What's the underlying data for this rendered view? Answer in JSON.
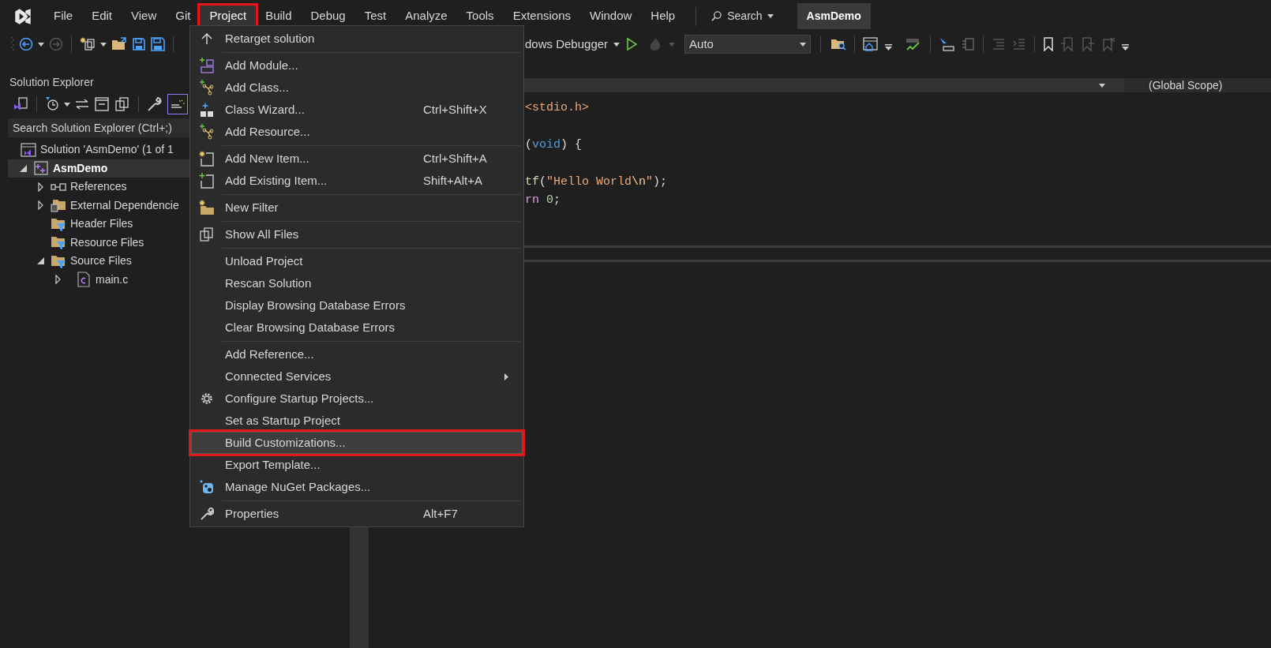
{
  "menubar": [
    {
      "label": "File",
      "open": false,
      "annotated": false
    },
    {
      "label": "Edit",
      "open": false,
      "annotated": false
    },
    {
      "label": "View",
      "open": false,
      "annotated": false
    },
    {
      "label": "Git",
      "open": false,
      "annotated": false
    },
    {
      "label": "Project",
      "open": true,
      "annotated": true
    },
    {
      "label": "Build",
      "open": false,
      "annotated": false
    },
    {
      "label": "Debug",
      "open": false,
      "annotated": false
    },
    {
      "label": "Test",
      "open": false,
      "annotated": false
    },
    {
      "label": "Analyze",
      "open": false,
      "annotated": false
    },
    {
      "label": "Tools",
      "open": false,
      "annotated": false
    },
    {
      "label": "Extensions",
      "open": false,
      "annotated": false
    },
    {
      "label": "Window",
      "open": false,
      "annotated": false
    },
    {
      "label": "Help",
      "open": false,
      "annotated": false
    }
  ],
  "search": "Search",
  "solution_badge": "AsmDemo",
  "toolbar": {
    "debugger": "dows Debugger",
    "configuration": "Auto"
  },
  "solution_explorer": {
    "title": "Solution Explorer",
    "search": {
      "placeholder": "Search Solution Explorer (Ctrl+;)"
    },
    "tree": [
      {
        "label": "Solution 'AsmDemo' (1 of 1",
        "kind": "solution",
        "expandable": false,
        "selected": false,
        "children": [
          {
            "label": "AsmDemo",
            "kind": "project",
            "expandable": true,
            "expanded": true,
            "selected": true,
            "children": [
              {
                "label": "References",
                "kind": "references",
                "expandable": true,
                "expanded": false,
                "selected": false
              },
              {
                "label": "External Dependencie",
                "kind": "external",
                "expandable": true,
                "expanded": false,
                "selected": false
              },
              {
                "label": "Header Files",
                "kind": "filter",
                "expandable": false,
                "selected": false
              },
              {
                "label": "Resource Files",
                "kind": "filter",
                "expandable": false,
                "selected": false
              },
              {
                "label": "Source Files",
                "kind": "filter",
                "expandable": true,
                "expanded": true,
                "selected": false,
                "children": [
                  {
                    "label": "main.c",
                    "kind": "file",
                    "expandable": true,
                    "expanded": false,
                    "selected": false
                  }
                ]
              }
            ]
          }
        ]
      }
    ]
  },
  "editor": {
    "scope": "(Global Scope)",
    "code_lines": [
      [
        {
          "text": "<stdio.h>",
          "kind": "string"
        }
      ],
      [
        {
          "text": "(",
          "kind": "punct"
        },
        {
          "text": "void",
          "kind": "keyword"
        },
        {
          "text": ") {",
          "kind": "punct"
        }
      ],
      [
        {
          "text": "tf",
          "kind": "function"
        },
        {
          "text": "(",
          "kind": "punct"
        },
        {
          "text": "\"Hello World",
          "kind": "string"
        },
        {
          "text": "\\n",
          "kind": "escape"
        },
        {
          "text": "\"",
          "kind": "string"
        },
        {
          "text": ");",
          "kind": "punct"
        }
      ],
      [
        {
          "text": "rn",
          "kind": "control"
        },
        {
          "text": " 0",
          "kind": "number"
        },
        {
          "text": ";",
          "kind": "punct"
        }
      ]
    ]
  },
  "project_menu": {
    "groups": [
      [
        {
          "label": "Retarget solution",
          "kind": "retarget",
          "submenu": false,
          "selected": false,
          "annotated": false
        }
      ],
      [
        {
          "label": "Add Module...",
          "kind": "module",
          "submenu": false,
          "selected": false,
          "annotated": false
        },
        {
          "label": "Add Class...",
          "kind": "class",
          "submenu": false,
          "selected": false,
          "annotated": false
        },
        {
          "label": "Class Wizard...",
          "kind": "wizard",
          "shortcut": "Ctrl+Shift+X",
          "submenu": false,
          "selected": false,
          "annotated": false
        },
        {
          "label": "Add Resource...",
          "kind": "class",
          "submenu": false,
          "selected": false,
          "annotated": false
        }
      ],
      [
        {
          "label": "Add New Item...",
          "kind": "new-item",
          "shortcut": "Ctrl+Shift+A",
          "submenu": false,
          "selected": false,
          "annotated": false
        },
        {
          "label": "Add Existing Item...",
          "kind": "existing-item",
          "shortcut": "Shift+Alt+A",
          "submenu": false,
          "selected": false,
          "annotated": false
        }
      ],
      [
        {
          "label": "New Filter",
          "kind": "filter",
          "submenu": false,
          "selected": false,
          "annotated": false
        }
      ],
      [
        {
          "label": "Show All Files",
          "kind": "show-all",
          "submenu": false,
          "selected": false,
          "annotated": false
        }
      ],
      [
        {
          "label": "Unload Project",
          "kind": "plain",
          "submenu": false,
          "selected": false,
          "annotated": false
        },
        {
          "label": "Rescan Solution",
          "kind": "plain",
          "submenu": false,
          "selected": false,
          "annotated": false
        },
        {
          "label": "Display Browsing Database Errors",
          "kind": "plain",
          "submenu": false,
          "selected": false,
          "annotated": false
        },
        {
          "label": "Clear Browsing Database Errors",
          "kind": "plain",
          "submenu": false,
          "selected": false,
          "annotated": false
        }
      ],
      [
        {
          "label": "Add Reference...",
          "kind": "plain",
          "submenu": false,
          "selected": false,
          "annotated": false
        },
        {
          "label": "Connected Services",
          "kind": "plain",
          "submenu": true,
          "selected": false,
          "annotated": false
        },
        {
          "label": "Configure Startup Projects...",
          "kind": "startup",
          "submenu": false,
          "selected": false,
          "annotated": false
        },
        {
          "label": "Set as Startup Project",
          "kind": "plain",
          "submenu": false,
          "selected": false,
          "annotated": false
        },
        {
          "label": "Build Customizations...",
          "kind": "plain",
          "submenu": false,
          "selected": true,
          "annotated": true
        },
        {
          "label": "Export Template...",
          "kind": "plain",
          "submenu": false,
          "selected": false,
          "annotated": false
        },
        {
          "label": "Manage NuGet Packages...",
          "kind": "nuget",
          "submenu": false,
          "selected": false,
          "annotated": false
        }
      ],
      [
        {
          "label": "Properties",
          "kind": "properties",
          "shortcut": "Alt+F7",
          "submenu": false,
          "selected": false,
          "annotated": false
        }
      ]
    ]
  }
}
